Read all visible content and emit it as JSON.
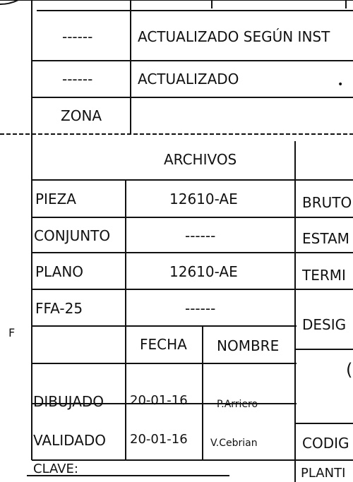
{
  "revisions": {
    "top_partial_left": "",
    "top_partial_right": "",
    "rows": [
      {
        "mark": "------",
        "text": "ACTUALIZADO SEGÚN INST"
      },
      {
        "mark": "------",
        "text": "ACTUALIZADO"
      }
    ]
  },
  "zona_label": "ZONA",
  "archivos_header": "ARCHIVOS",
  "files": [
    {
      "label": "PIEZA",
      "value": "12610-AE"
    },
    {
      "label": "CONJUNTO",
      "value": "------"
    },
    {
      "label": "PLANO",
      "value": "12610-AE"
    },
    {
      "label": "FFA-25",
      "value": "------"
    }
  ],
  "right_labels": [
    "BRUTO",
    "ESTAM",
    "TERMI",
    "DESIG",
    "(",
    "CODIG"
  ],
  "sign_table": {
    "headers": {
      "fecha": "FECHA",
      "nombre": "NOMBRE"
    },
    "rows": [
      {
        "label": "DIBUJADO",
        "fecha": "20-01-16",
        "nombre": "P.Arriero"
      },
      {
        "label": "VALIDADO",
        "fecha": "20-01-16",
        "nombre": "V.Cebrian"
      }
    ]
  },
  "clave_label": "CLAVE:",
  "plantilla_label": "PLANTI",
  "margin_letter": "F"
}
